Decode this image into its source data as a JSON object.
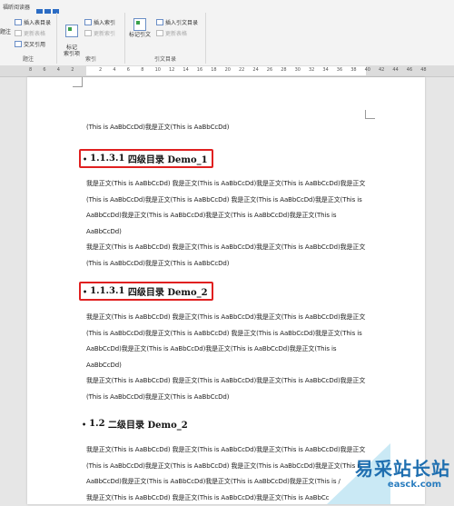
{
  "ribbon": {
    "tab_label": "福昕阅读器",
    "footnote_group": {
      "label": "题注",
      "partial_label": "题注",
      "insert_table_of_figures": "插入表目录",
      "update_table": "更新表格",
      "cross_reference": "交叉引用"
    },
    "index_group": {
      "label": "索引",
      "mark_entry": "标记\n索引项",
      "insert_index": "插入索引",
      "update_index": "更新索引"
    },
    "citation_group": {
      "label": "引文目录",
      "mark_citation": "标记引文",
      "insert_toa": "插入引文目录",
      "update_table": "更新表格"
    }
  },
  "ruler": {
    "numbers": [
      "8",
      "6",
      "4",
      "2",
      "",
      "2",
      "4",
      "6",
      "8",
      "10",
      "12",
      "14",
      "16",
      "18",
      "20",
      "22",
      "24",
      "26",
      "28",
      "30",
      "32",
      "34",
      "36",
      "38",
      "40",
      "42",
      "44",
      "46",
      "48"
    ]
  },
  "document": {
    "first_line": "(This is AaBbCcDd)我是正文(This is AaBbCcDd)",
    "heading1": {
      "number": "1.1.3.1",
      "text": "四级目录 Demo_1"
    },
    "para1": [
      "我是正文(This is AaBbCcDd) 我是正文(This is AaBbCcDd)我是正文(This is AaBbCcDd)我是正文",
      "(This is AaBbCcDd)我是正文(This is AaBbCcDd) 我是正文(This is AaBbCcDd)我是正文(This is",
      "AaBbCcDd)我是正文(This is AaBbCcDd)我是正文(This is AaBbCcDd)我是正文(This is AaBbCcDd)",
      "我是正文(This is AaBbCcDd) 我是正文(This is AaBbCcDd)我是正文(This is AaBbCcDd)我是正文",
      "(This is AaBbCcDd)我是正文(This is AaBbCcDd)"
    ],
    "heading2": {
      "number": "1.1.3.1",
      "text": "四级目录 Demo_2"
    },
    "para2": [
      "我是正文(This is AaBbCcDd) 我是正文(This is AaBbCcDd)我是正文(This is AaBbCcDd)我是正文",
      "(This is AaBbCcDd)我是正文(This is AaBbCcDd) 我是正文(This is AaBbCcDd)我是正文(This is",
      "AaBbCcDd)我是正文(This is AaBbCcDd)我是正文(This is AaBbCcDd)我是正文(This is AaBbCcDd)",
      "我是正文(This is AaBbCcDd) 我是正文(This is AaBbCcDd)我是正文(This is AaBbCcDd)我是正文",
      "(This is AaBbCcDd)我是正文(This is AaBbCcDd)"
    ],
    "heading3": {
      "number": "1.2",
      "text": "二级目录 Demo_2"
    },
    "para3": [
      "我是正文(This is AaBbCcDd) 我是正文(This is AaBbCcDd)我是正文(This is AaBbCcDd)我是正文",
      "(This is AaBbCcDd)我是正文(This is AaBbCcDd) 我是正文(This is AaBbCcDd)我是正文(This is",
      "AaBbCcDd)我是正文(This is AaBbCcDd)我是正文(This is AaBbCcDd)我是正文(This is /",
      "我是正文(This is AaBbCcDd) 我是正文(This is AaBbCcDd)我是正文(This is AaBbCc"
    ]
  },
  "watermark": {
    "text": "易采站长站",
    "url": "easck.com"
  },
  "colors": {
    "highlight_box": "#e02020",
    "accent": "#2b6cc4"
  }
}
